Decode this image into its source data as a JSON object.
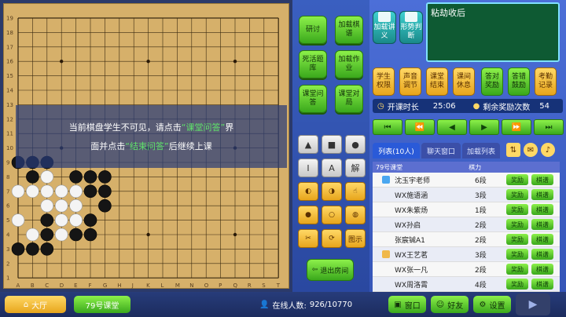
{
  "overlay": {
    "line1_a": "当前棋盘学生不可见，请点击",
    "line1_b": "“课堂问答”",
    "line1_c": "界",
    "line2_a": "面并点击",
    "line2_b": "“结束问答”",
    "line2_c": "后继续上课"
  },
  "board": {
    "cols": [
      "A",
      "B",
      "C",
      "D",
      "E",
      "F",
      "G",
      "H",
      "J",
      "K",
      "L",
      "M",
      "N",
      "O",
      "P",
      "Q",
      "R",
      "S",
      "T"
    ],
    "rows": [
      "19",
      "18",
      "17",
      "16",
      "15",
      "14",
      "13",
      "12",
      "11",
      "10",
      "9",
      "8",
      "7",
      "6",
      "5",
      "4",
      "3",
      "2",
      "1"
    ]
  },
  "tools": {
    "review": "研讨",
    "load_record": "加载棋谱",
    "life_death": "死活题库",
    "load_homework": "加载作业",
    "class_qa": "课堂问答",
    "class_match": "课堂对局",
    "exit_room": "退出房间",
    "sym_i": "I",
    "sym_a": "A",
    "sym_explain": "解",
    "sym_diagram": "图示"
  },
  "right": {
    "load_lecture": "加载讲义",
    "position_judge": "形势判断",
    "message": "粘劫收后",
    "student_perm": "学生权限",
    "audio_adjust": "声音调节",
    "class_end": "课堂结束",
    "class_break": "课间休息",
    "answer_reward": "答对奖励",
    "answer_encourage": "答错鼓励",
    "exam_record": "考勤记录",
    "class_duration_label": "开课时长",
    "class_duration": "25:06",
    "remaining_reward_label": "剩余奖励次数",
    "remaining_reward": "54",
    "tabs": [
      "列表(10人)",
      "聊天窗口",
      "加载列表"
    ],
    "list_header_room": "79号课堂",
    "list_header_rank": "棋力",
    "reward_label": "奖励",
    "chess_label": "棋谱",
    "students": [
      {
        "name": "沈玉宇老师",
        "rank": "6段"
      },
      {
        "name": "WX施语涵",
        "rank": "3段"
      },
      {
        "name": "WX朱紫炀",
        "rank": "1段"
      },
      {
        "name": "WX孙启",
        "rank": "2段"
      },
      {
        "name": "张宸铖A1",
        "rank": "2段"
      },
      {
        "name": "WX王艺茗",
        "rank": "3段"
      },
      {
        "name": "WX张一凡",
        "rank": "2段"
      },
      {
        "name": "WX周洛霄",
        "rank": "4段"
      }
    ]
  },
  "bottom": {
    "lobby": "大厅",
    "room": "79号课堂",
    "online_label": "在线人数:",
    "online_count": "926/10770",
    "window": "窗口",
    "friends": "好友",
    "settings": "设置"
  },
  "colors": {
    "board": "#d6b06a",
    "accent_green": "#5fe36a",
    "panel_blue": "#3555b8"
  }
}
